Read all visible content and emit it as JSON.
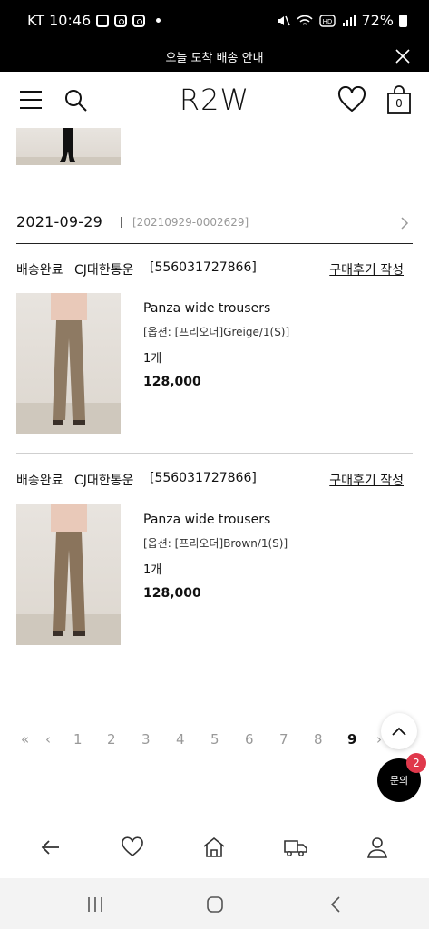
{
  "status_bar": {
    "carrier_time": "KT 10:46",
    "battery": "72%"
  },
  "banner": {
    "text": "오늘 도착 배송 안내"
  },
  "header": {
    "logo": "R2W",
    "cart_count": "0"
  },
  "order": {
    "date": "2021-09-29",
    "number": "[20210929-0002629]"
  },
  "items": [
    {
      "ship_status": "배송완료",
      "carrier": "CJ대한통운",
      "tracking": "[556031727866]",
      "review_label": "구매후기 작성",
      "name": "Panza wide trousers",
      "option": "[옵션: [프리오더]Greige/1(S)]",
      "qty": "1개",
      "price": "128,000"
    },
    {
      "ship_status": "배송완료",
      "carrier": "CJ대한통운",
      "tracking": "[556031727866]",
      "review_label": "구매후기 작성",
      "name": "Panza wide trousers",
      "option": "[옵션: [프리오더]Brown/1(S)]",
      "qty": "1개",
      "price": "128,000"
    }
  ],
  "pagination": {
    "first": "«",
    "prev": "‹",
    "pages": [
      "1",
      "2",
      "3",
      "4",
      "5",
      "6",
      "7",
      "8",
      "9"
    ],
    "current": "9",
    "next": "›"
  },
  "floating": {
    "inquiry_label": "문의",
    "inquiry_badge": "2"
  },
  "icons": {
    "menu": "hamburger-icon",
    "search": "search-icon",
    "wishlist": "heart-icon",
    "cart": "bag-icon",
    "back": "arrow-left-icon",
    "home": "home-icon",
    "delivery": "truck-icon",
    "account": "user-icon"
  }
}
